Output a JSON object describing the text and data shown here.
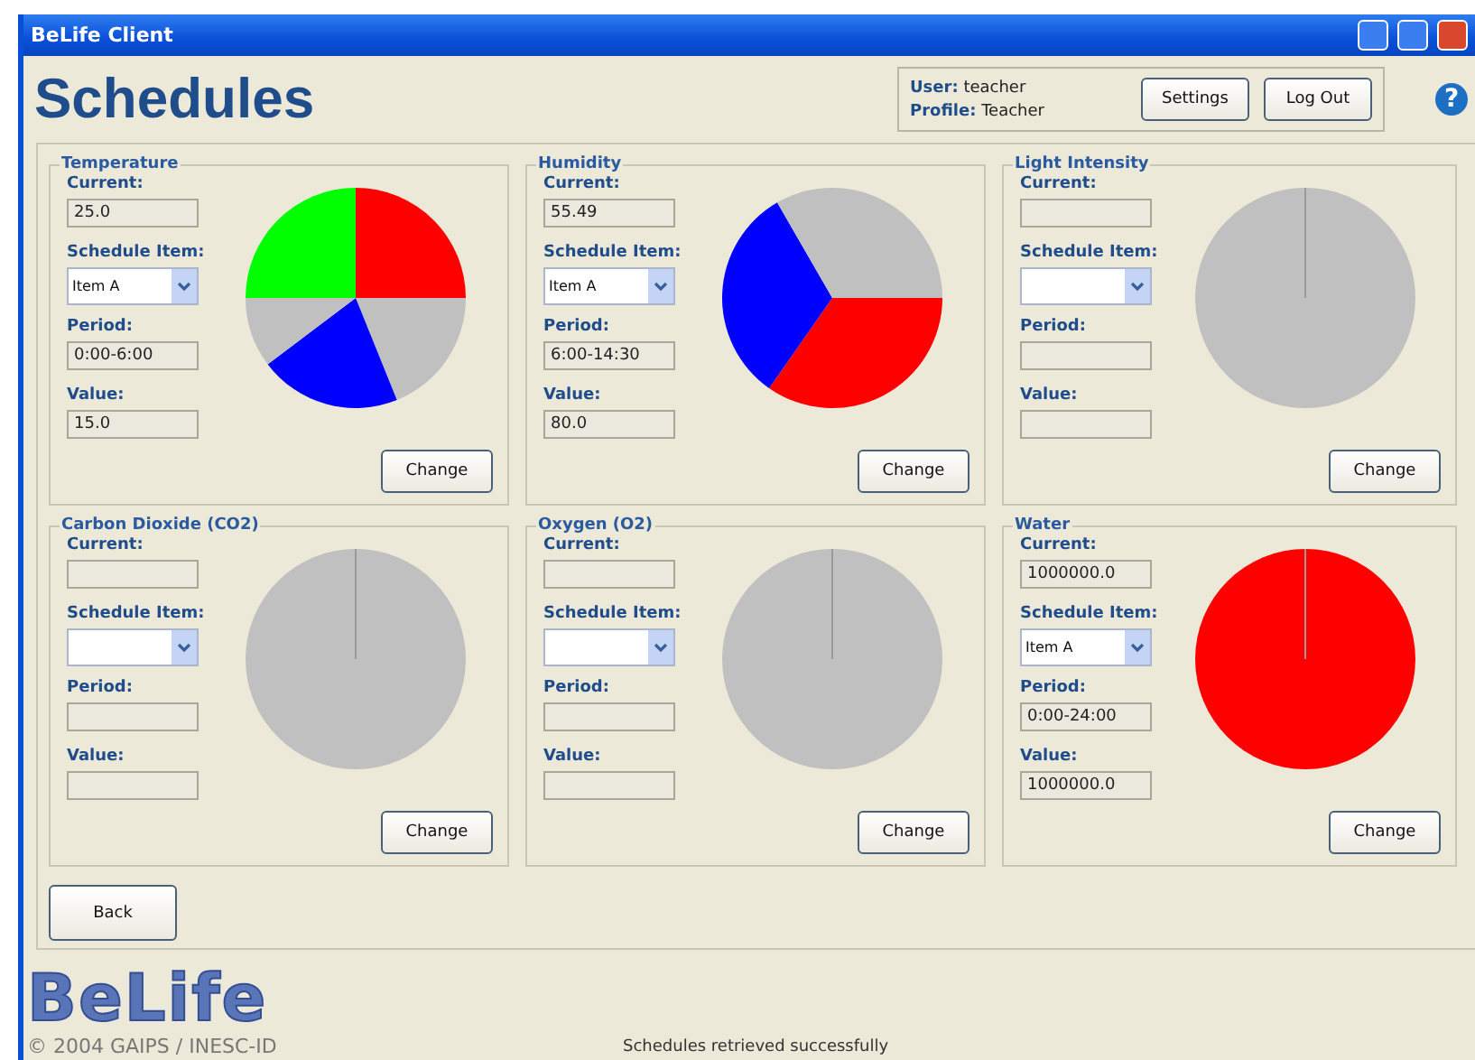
{
  "window": {
    "title": "BeLife Client"
  },
  "header": {
    "title": "Schedules",
    "user_label": "User:",
    "user": "teacher",
    "profile_label": "Profile:",
    "profile": "Teacher",
    "buttons": [
      "Settings",
      "Log Out"
    ],
    "help": "?"
  },
  "panels": [
    {
      "title": "Temperature",
      "fields": [
        {
          "kind": "text",
          "label": "Current:",
          "value": "25.0"
        },
        {
          "kind": "select",
          "label": "Schedule Item:",
          "value": "Item A"
        },
        {
          "kind": "text",
          "label": "Period:",
          "value": "0:00-6:00"
        },
        {
          "kind": "text",
          "label": "Value:",
          "value": "15.0"
        }
      ],
      "button": "Change"
    },
    {
      "title": "Humidity",
      "fields": [
        {
          "kind": "text",
          "label": "Current:",
          "value": "55.49"
        },
        {
          "kind": "select",
          "label": "Schedule Item:",
          "value": "Item A"
        },
        {
          "kind": "text",
          "label": "Period:",
          "value": "6:00-14:30"
        },
        {
          "kind": "text",
          "label": "Value:",
          "value": "80.0"
        }
      ],
      "button": "Change"
    },
    {
      "title": "Light Intensity",
      "fields": [
        {
          "kind": "text",
          "label": "Current:"
        },
        {
          "kind": "select",
          "label": "Schedule Item:"
        },
        {
          "kind": "text",
          "label": "Period:"
        },
        {
          "kind": "text",
          "label": "Value:"
        }
      ],
      "button": "Change"
    },
    {
      "title": "Carbon Dioxide (CO2)",
      "fields": [
        {
          "kind": "text",
          "label": "Current:"
        },
        {
          "kind": "select",
          "label": "Schedule Item:"
        },
        {
          "kind": "text",
          "label": "Period:"
        },
        {
          "kind": "text",
          "label": "Value:"
        }
      ],
      "button": "Change"
    },
    {
      "title": "Oxygen (O2)",
      "fields": [
        {
          "kind": "text",
          "label": "Current:"
        },
        {
          "kind": "select",
          "label": "Schedule Item:"
        },
        {
          "kind": "text",
          "label": "Period:"
        },
        {
          "kind": "text",
          "label": "Value:"
        }
      ],
      "button": "Change"
    },
    {
      "title": "Water",
      "fields": [
        {
          "kind": "text",
          "label": "Current:",
          "value": "1000000.0"
        },
        {
          "kind": "select",
          "label": "Schedule Item:",
          "value": "Item A"
        },
        {
          "kind": "text",
          "label": "Period:",
          "value": "0:00-24:00"
        },
        {
          "kind": "text",
          "label": "Value:",
          "value": "1000000.0"
        }
      ],
      "button": "Change"
    }
  ],
  "back_button": "Back",
  "footer": {
    "logo": "BeLife",
    "copyright": "© 2004 GAIPS / INESC-ID",
    "status": "Schedules retrieved successfully"
  }
}
